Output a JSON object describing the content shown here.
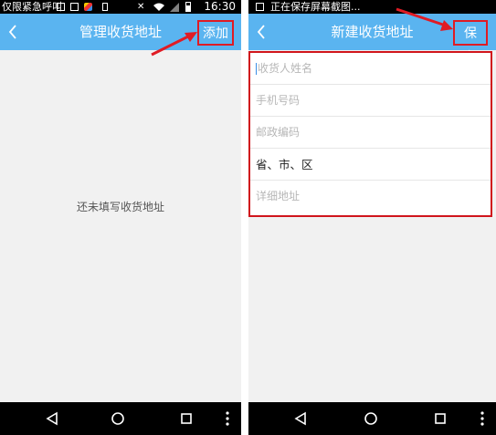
{
  "left_screen": {
    "status_text": "仅限紧急呼叫",
    "time": "16:30",
    "title": "管理收货地址",
    "add_label": "添加",
    "empty_message": "还未填写收货地址"
  },
  "right_screen": {
    "status_text": "正在保存屏幕截图...",
    "title": "新建收货地址",
    "save_label": "保存",
    "fields": [
      {
        "placeholder": "收货人姓名"
      },
      {
        "placeholder": "手机号码"
      },
      {
        "placeholder": "邮政编码"
      },
      {
        "value": "省、市、区"
      },
      {
        "placeholder": "详细地址"
      }
    ]
  },
  "colors": {
    "navbar": "#5ab4f0",
    "highlight": "#d0151c",
    "background": "#f1f1f1"
  },
  "icons": [
    "back-arrow-icon",
    "nav-back-triangle-icon",
    "nav-home-circle-icon",
    "nav-recent-square-icon",
    "nav-menu-dots-icon"
  ]
}
